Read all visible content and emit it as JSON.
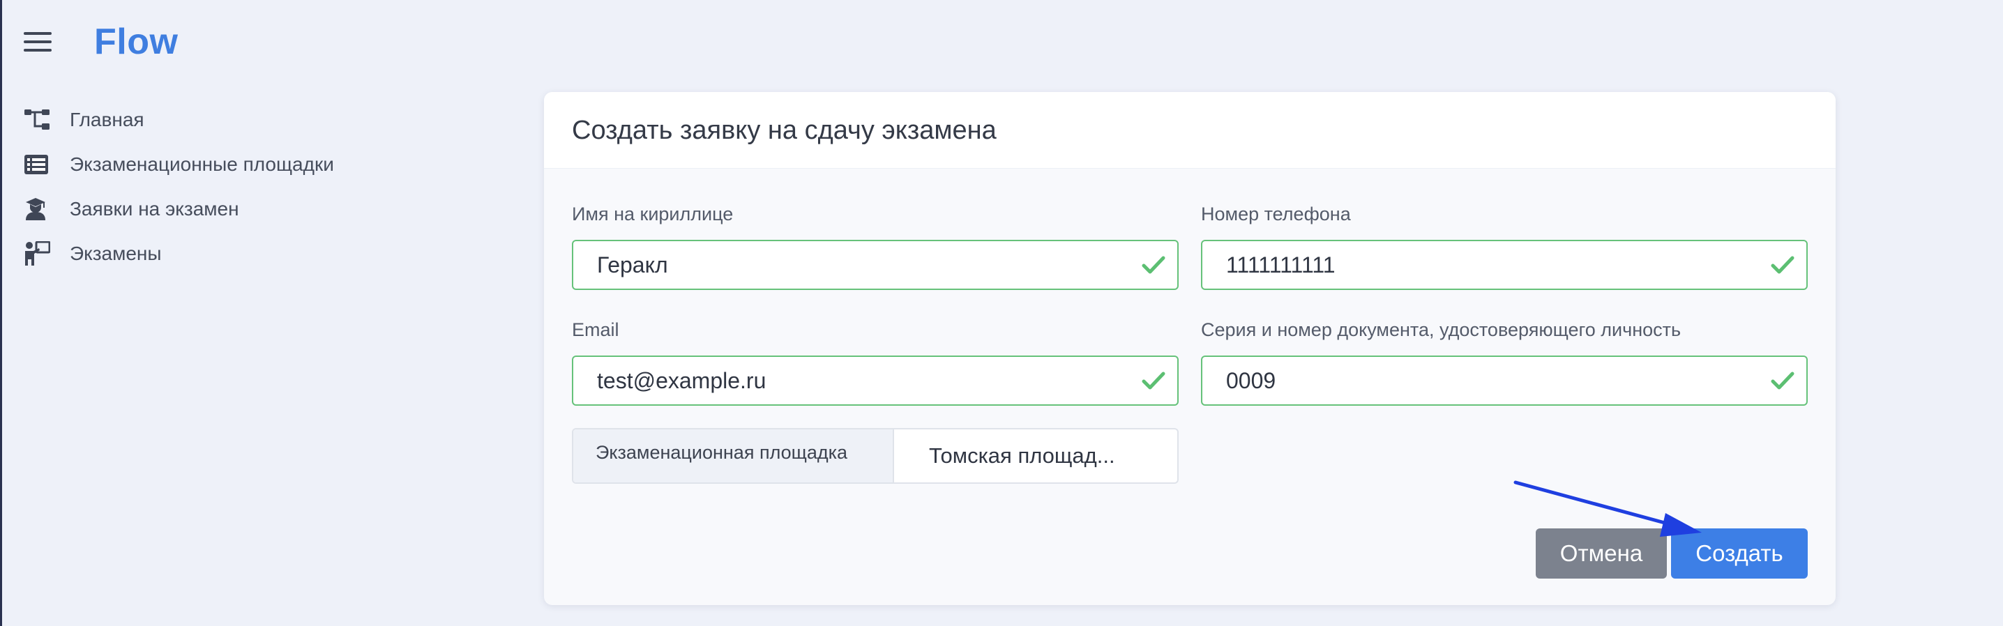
{
  "app": {
    "brand": "Flow"
  },
  "sidebar": {
    "items": [
      {
        "label": "Главная",
        "icon": "sitemap-icon"
      },
      {
        "label": "Экзаменационные площадки",
        "icon": "list-icon"
      },
      {
        "label": "Заявки на экзамен",
        "icon": "graduate-icon"
      },
      {
        "label": "Экзамены",
        "icon": "presentation-icon"
      }
    ]
  },
  "form": {
    "title": "Создать заявку на сдачу экзамена",
    "fields": {
      "name": {
        "label": "Имя на кириллице",
        "value": "Геракл"
      },
      "phone": {
        "label": "Номер телефона",
        "value": "1111111111"
      },
      "email": {
        "label": "Email",
        "value": "test@example.ru"
      },
      "document": {
        "label": "Серия и номер документа, удостоверяющего личность",
        "value": "0009"
      }
    },
    "venue": {
      "label": "Экзаменационная площадка",
      "selected": "Томская площад..."
    },
    "buttons": {
      "cancel": "Отмена",
      "create": "Создать"
    }
  },
  "colors": {
    "brand": "#3f7ee0",
    "valid_border": "#66c27a",
    "primary_button": "#3d7fe6",
    "secondary_button": "#7c828e",
    "annotation_arrow": "#1f3fe0"
  }
}
